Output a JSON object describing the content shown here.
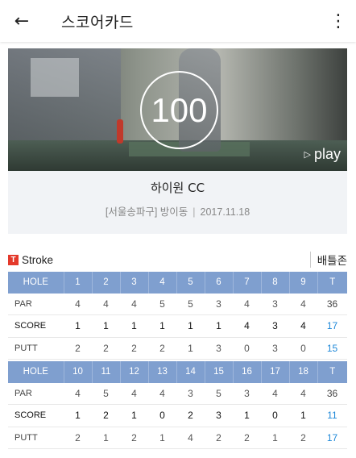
{
  "appbar": {
    "back_icon": "←",
    "title": "스코어카드",
    "more_icon": "⋮"
  },
  "video": {
    "score": "100",
    "play_icon": "▷",
    "play_label": "play"
  },
  "course": {
    "name": "하이원 CC",
    "region": "[서울송파구] 방이동",
    "separator": "|",
    "date": "2017.11.18"
  },
  "mode": {
    "badge": "T",
    "label": "Stroke",
    "battle_label": "배틀존"
  },
  "front_nine": {
    "header": [
      "HOLE",
      "1",
      "2",
      "3",
      "4",
      "5",
      "6",
      "7",
      "8",
      "9",
      "T"
    ],
    "par": [
      "PAR",
      "4",
      "4",
      "4",
      "5",
      "5",
      "3",
      "4",
      "3",
      "4",
      "36"
    ],
    "score": [
      "SCORE",
      "1",
      "1",
      "1",
      "1",
      "1",
      "1",
      "4",
      "3",
      "4",
      "17"
    ],
    "putt": [
      "PUTT",
      "2",
      "2",
      "2",
      "2",
      "1",
      "3",
      "0",
      "3",
      "0",
      "15"
    ]
  },
  "back_nine": {
    "header": [
      "HOLE",
      "10",
      "11",
      "12",
      "13",
      "14",
      "15",
      "16",
      "17",
      "18",
      "T"
    ],
    "par": [
      "PAR",
      "4",
      "5",
      "4",
      "4",
      "3",
      "5",
      "3",
      "4",
      "4",
      "36"
    ],
    "score": [
      "SCORE",
      "1",
      "2",
      "1",
      "0",
      "2",
      "3",
      "1",
      "0",
      "1",
      "11"
    ],
    "putt": [
      "PUTT",
      "2",
      "1",
      "2",
      "1",
      "4",
      "2",
      "2",
      "1",
      "2",
      "17"
    ]
  },
  "colors": {
    "header_bg": "#7f9fcf",
    "total_blue": "#1e88d8",
    "badge_red": "#e4392b"
  }
}
